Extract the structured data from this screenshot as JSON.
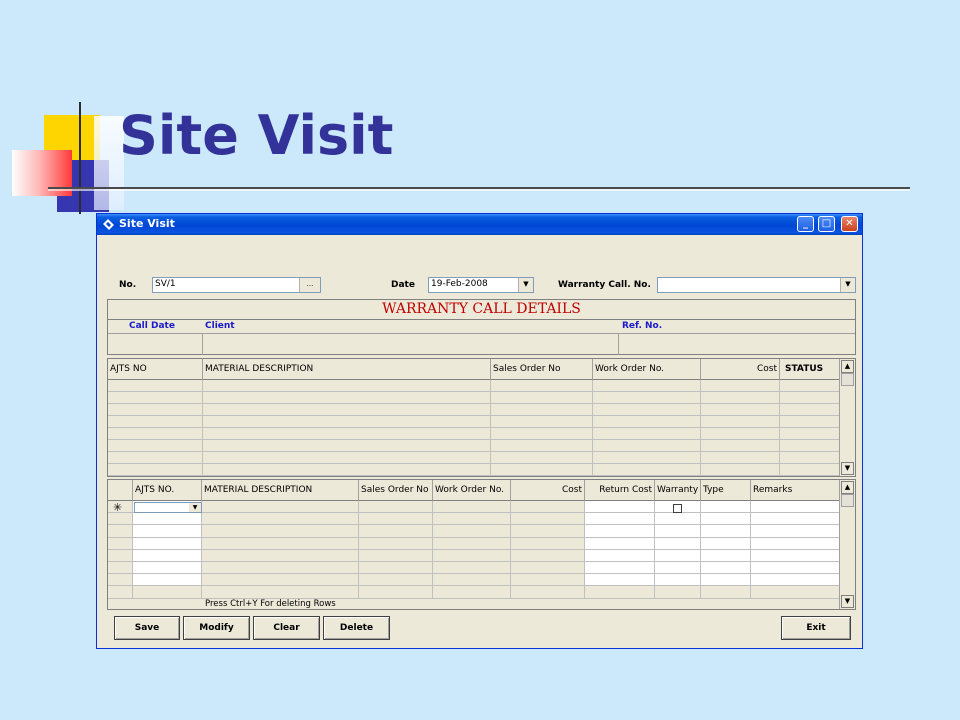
{
  "slide": {
    "title": "Site Visit"
  },
  "window": {
    "title": "Site Visit",
    "icon": "app-icon",
    "controls": {
      "minimize": "_",
      "maximize": "□",
      "close": "✕"
    }
  },
  "form": {
    "no_label": "No.",
    "no_value": "SV/1",
    "no_browse": "...",
    "date_label": "Date",
    "date_value": "19-Feb-2008",
    "warranty_call_label": "Warranty Call. No.",
    "warranty_call_value": "",
    "dropdown_glyph": "▼"
  },
  "warranty_details": {
    "title": "WARRANTY CALL DETAILS",
    "columns": [
      "Call Date",
      "Client",
      "Ref. No."
    ]
  },
  "upper_grid": {
    "columns": [
      "AJTS NO",
      "MATERIAL DESCRIPTION",
      "Sales Order No",
      "Work Order No.",
      "Cost",
      "STATUS"
    ]
  },
  "lower_grid": {
    "columns": [
      "AJTS NO.",
      "MATERIAL DESCRIPTION",
      "Sales Order No",
      "Work Order No.",
      "Cost",
      "Return Cost",
      "Warranty",
      "Type",
      "Remarks"
    ],
    "new_row_marker": "✳",
    "footer_hint": "Press Ctrl+Y For deleting Rows"
  },
  "scroll": {
    "up": "▲",
    "down": "▼"
  },
  "buttons": {
    "save": "Save",
    "modify": "Modify",
    "clear": "Clear",
    "delete": "Delete",
    "exit": "Exit"
  },
  "colors": {
    "slide_bg": "#cce9fb",
    "title_color": "#323299",
    "window_face": "#ece9d8",
    "titlebar": "#0046d5",
    "details_title": "#c00000",
    "details_headers": "#1a1acc"
  }
}
